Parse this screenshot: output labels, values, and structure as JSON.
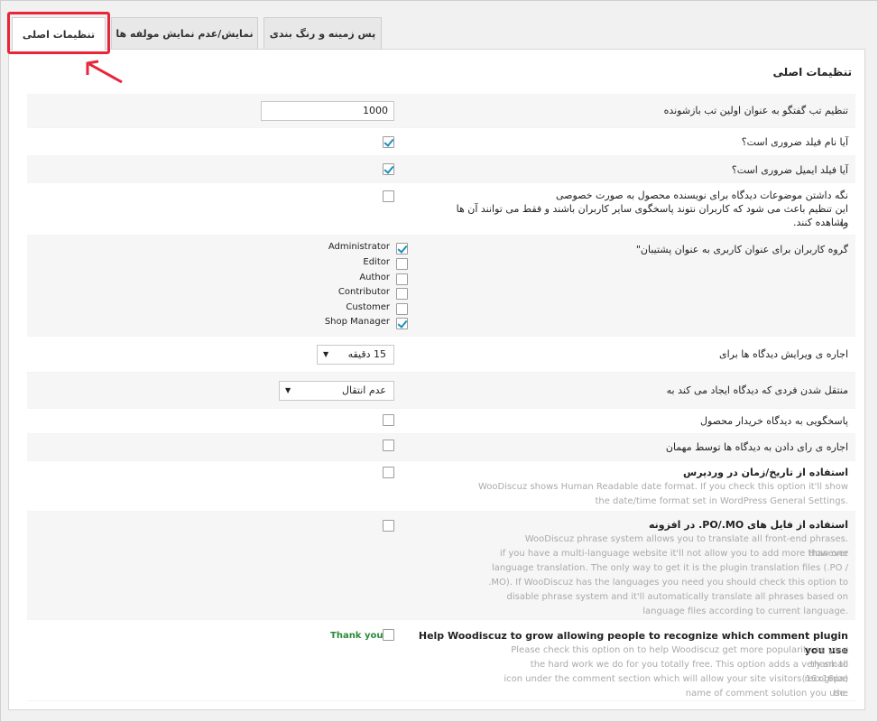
{
  "tabs": [
    {
      "label": "تنظیمات اصلی",
      "active": true
    },
    {
      "label": "نمایش/عدم نمایش مولفه ها",
      "active": false
    },
    {
      "label": "پس زمینه و رنگ بندی",
      "active": false
    }
  ],
  "panel_title": "تنظیمات اصلی",
  "rows": {
    "first_tab": {
      "label": "تنظیم تب گفتگو به عنوان اولین تب بازشونده",
      "value": "1000"
    },
    "name_required": {
      "label": "آیا نام فیلد ضروری است؟",
      "checked": true
    },
    "email_required": {
      "label": "آیا فیلد ایمیل ضروری است؟",
      "checked": true
    },
    "private_topics": {
      "line1": "نگه داشتن موضوعات دیدگاه برای نویسنده محصول به صورت خصوصی",
      "line2": "این تنظیم باعث می شود که کاربران نتوند پاسخگوی سایر کاربران باشند و فقط می توانند آن ها را",
      "line3": "مشاهده کنند.",
      "checked": false
    },
    "support_roles": {
      "label": "گروه کاربران برای عنوان کاربری به عنوان پشتیبان\"",
      "roles": [
        {
          "name": "Administrator",
          "checked": true
        },
        {
          "name": "Editor",
          "checked": false
        },
        {
          "name": "Author",
          "checked": false
        },
        {
          "name": "Contributor",
          "checked": false
        },
        {
          "name": "Customer",
          "checked": false
        },
        {
          "name": "Shop Manager",
          "checked": true
        }
      ]
    },
    "edit_time": {
      "label": "اجاره ی ویرایش دیدگاه ها برای",
      "selected": "15 دقیقه"
    },
    "redirect": {
      "label": "منتقل شدن فردی که دیدگاه ایجاد می کند به",
      "selected": "عدم انتقال"
    },
    "buyer_reply": {
      "label": "پاسخگویی به دیدگاه خریدار محصول",
      "checked": false
    },
    "guest_vote": {
      "label": "اجاره ی رای دادن به دیدگاه ها توسط مهمان",
      "checked": false
    },
    "wp_date": {
      "label": "استفاده از تاریخ/زمان در وردپرس",
      "desc": [
        "WooDiscuz shows Human Readable date format. If you check this option it'll show",
        "the date/time format set in WordPress General Settings."
      ],
      "checked": false
    },
    "po_mo": {
      "label": "استفاده از فایل های PO/.MO. در افزونه",
      "desc": [
        "WooDiscuz phrase system allows you to translate all front-end phrases. However",
        "if you have a multi-language website it'll not allow you to add more than one",
        "language translation. The only way to get it is the plugin translation files (.PO /",
        ".MO). If WooDiscuz has the languages you need you should check this option to",
        "disable phrase system and it'll automatically translate all phrases based on",
        "language files according to current language."
      ],
      "checked": false
    },
    "help_grow": {
      "label": "Help Woodiscuz to grow allowing people to recognize which comment plugin you use",
      "desc": [
        "Please check this option on to help Woodiscuz get more popularity as your thank to",
        "the hard work we do for you totally free. This option adds a very small (16x16px)",
        "icon under the comment section which will allow your site visitors recognize the",
        "name of comment solution you use."
      ],
      "thank_you": "Thank you!",
      "checked": false
    }
  },
  "colors": {
    "highlight": "#e8253a",
    "check": "#1e8cbe",
    "thank": "#2a8a3a"
  }
}
